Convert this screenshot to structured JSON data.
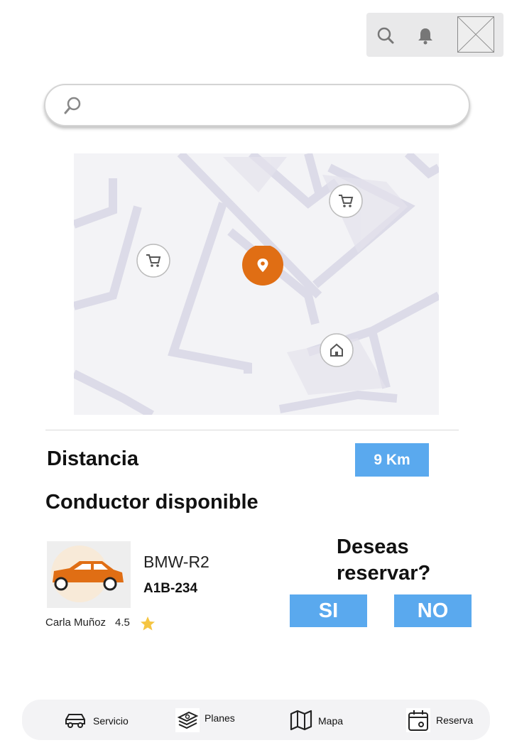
{
  "header": {
    "search_icon": "search-icon",
    "bell_icon": "bell-icon",
    "avatar": "avatar-placeholder"
  },
  "search": {
    "placeholder": "",
    "icon": "magnifier-icon"
  },
  "map": {
    "markers": [
      "shopping-cart-icon",
      "shopping-cart-icon",
      "location-pin-icon",
      "home-icon"
    ],
    "accent_color": "#e06e14",
    "road_color": "#dcdbe8"
  },
  "distance": {
    "label": "Distancia",
    "value": "9 Km"
  },
  "driver_section": {
    "title": "Conductor disponible"
  },
  "vehicle": {
    "model": "BMW-R2",
    "plate": "A1B-234",
    "driver_name": "Carla Muñoz",
    "rating": "4.5",
    "car_color": "#e06e14"
  },
  "booking": {
    "question": "Deseas reservar?",
    "yes_label": "SI",
    "no_label": "NO",
    "button_color": "#5aa9ee"
  },
  "nav": {
    "items": [
      {
        "label": "Servicio",
        "icon": "car-icon"
      },
      {
        "label": "Planes",
        "icon": "money-stack-icon"
      },
      {
        "label": "Mapa",
        "icon": "map-icon"
      },
      {
        "label": "Reserva",
        "icon": "calendar-icon"
      }
    ]
  }
}
